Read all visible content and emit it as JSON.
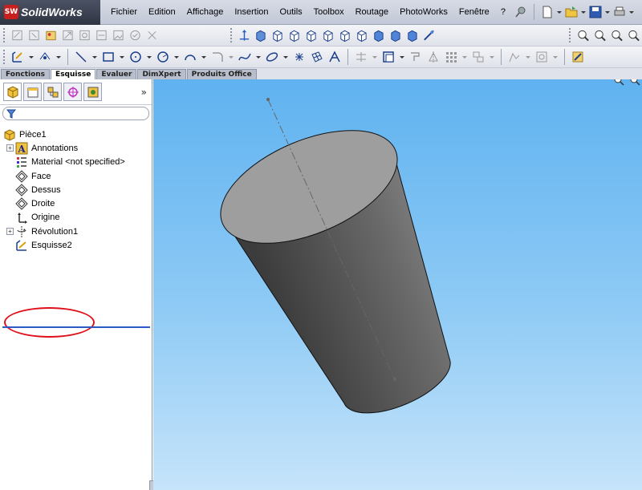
{
  "app": {
    "logo_mark": "SW",
    "logo_text": "SolidWorks"
  },
  "menu": {
    "items": [
      "Fichier",
      "Edition",
      "Affichage",
      "Insertion",
      "Outils",
      "Toolbox",
      "Routage",
      "PhotoWorks",
      "Fenêtre",
      "?"
    ]
  },
  "command_tabs": {
    "items": [
      "Fonctions",
      "Esquisse",
      "Evaluer",
      "DimXpert",
      "Produits Office"
    ],
    "active": "Esquisse"
  },
  "feature_tree": {
    "root": "Pièce1",
    "items": [
      {
        "label": "Annotations",
        "icon": "annotations-icon",
        "expandable": true
      },
      {
        "label": "Material <not specified>",
        "icon": "material-icon",
        "expandable": false
      },
      {
        "label": "Face",
        "icon": "plane-icon",
        "expandable": false
      },
      {
        "label": "Dessus",
        "icon": "plane-icon",
        "expandable": false
      },
      {
        "label": "Droite",
        "icon": "plane-icon",
        "expandable": false
      },
      {
        "label": "Origine",
        "icon": "origin-icon",
        "expandable": false
      },
      {
        "label": "Révolution1",
        "icon": "revolve-icon",
        "expandable": true
      },
      {
        "label": "Esquisse2",
        "icon": "sketch-icon",
        "expandable": false
      }
    ],
    "highlighted_item": "Esquisse2"
  },
  "colors": {
    "accent_highlight": "#e0101a",
    "viewport_top": "#5fb2f0",
    "viewport_bottom": "#c6e4fa",
    "rollback_bar": "#2c59c7"
  }
}
